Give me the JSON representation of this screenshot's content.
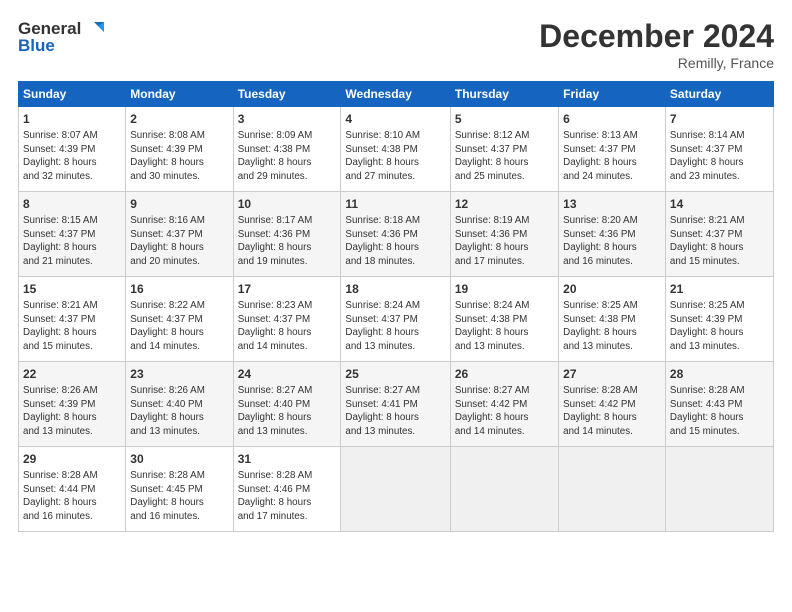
{
  "header": {
    "title": "December 2024",
    "location": "Remilly, France"
  },
  "logo": {
    "line1": "General",
    "line2": "Blue"
  },
  "days_of_week": [
    "Sunday",
    "Monday",
    "Tuesday",
    "Wednesday",
    "Thursday",
    "Friday",
    "Saturday"
  ],
  "weeks": [
    [
      {
        "num": "1",
        "info": "Sunrise: 8:07 AM\nSunset: 4:39 PM\nDaylight: 8 hours\nand 32 minutes."
      },
      {
        "num": "2",
        "info": "Sunrise: 8:08 AM\nSunset: 4:39 PM\nDaylight: 8 hours\nand 30 minutes."
      },
      {
        "num": "3",
        "info": "Sunrise: 8:09 AM\nSunset: 4:38 PM\nDaylight: 8 hours\nand 29 minutes."
      },
      {
        "num": "4",
        "info": "Sunrise: 8:10 AM\nSunset: 4:38 PM\nDaylight: 8 hours\nand 27 minutes."
      },
      {
        "num": "5",
        "info": "Sunrise: 8:12 AM\nSunset: 4:37 PM\nDaylight: 8 hours\nand 25 minutes."
      },
      {
        "num": "6",
        "info": "Sunrise: 8:13 AM\nSunset: 4:37 PM\nDaylight: 8 hours\nand 24 minutes."
      },
      {
        "num": "7",
        "info": "Sunrise: 8:14 AM\nSunset: 4:37 PM\nDaylight: 8 hours\nand 23 minutes."
      }
    ],
    [
      {
        "num": "8",
        "info": "Sunrise: 8:15 AM\nSunset: 4:37 PM\nDaylight: 8 hours\nand 21 minutes."
      },
      {
        "num": "9",
        "info": "Sunrise: 8:16 AM\nSunset: 4:37 PM\nDaylight: 8 hours\nand 20 minutes."
      },
      {
        "num": "10",
        "info": "Sunrise: 8:17 AM\nSunset: 4:36 PM\nDaylight: 8 hours\nand 19 minutes."
      },
      {
        "num": "11",
        "info": "Sunrise: 8:18 AM\nSunset: 4:36 PM\nDaylight: 8 hours\nand 18 minutes."
      },
      {
        "num": "12",
        "info": "Sunrise: 8:19 AM\nSunset: 4:36 PM\nDaylight: 8 hours\nand 17 minutes."
      },
      {
        "num": "13",
        "info": "Sunrise: 8:20 AM\nSunset: 4:36 PM\nDaylight: 8 hours\nand 16 minutes."
      },
      {
        "num": "14",
        "info": "Sunrise: 8:21 AM\nSunset: 4:37 PM\nDaylight: 8 hours\nand 15 minutes."
      }
    ],
    [
      {
        "num": "15",
        "info": "Sunrise: 8:21 AM\nSunset: 4:37 PM\nDaylight: 8 hours\nand 15 minutes."
      },
      {
        "num": "16",
        "info": "Sunrise: 8:22 AM\nSunset: 4:37 PM\nDaylight: 8 hours\nand 14 minutes."
      },
      {
        "num": "17",
        "info": "Sunrise: 8:23 AM\nSunset: 4:37 PM\nDaylight: 8 hours\nand 14 minutes."
      },
      {
        "num": "18",
        "info": "Sunrise: 8:24 AM\nSunset: 4:37 PM\nDaylight: 8 hours\nand 13 minutes."
      },
      {
        "num": "19",
        "info": "Sunrise: 8:24 AM\nSunset: 4:38 PM\nDaylight: 8 hours\nand 13 minutes."
      },
      {
        "num": "20",
        "info": "Sunrise: 8:25 AM\nSunset: 4:38 PM\nDaylight: 8 hours\nand 13 minutes."
      },
      {
        "num": "21",
        "info": "Sunrise: 8:25 AM\nSunset: 4:39 PM\nDaylight: 8 hours\nand 13 minutes."
      }
    ],
    [
      {
        "num": "22",
        "info": "Sunrise: 8:26 AM\nSunset: 4:39 PM\nDaylight: 8 hours\nand 13 minutes."
      },
      {
        "num": "23",
        "info": "Sunrise: 8:26 AM\nSunset: 4:40 PM\nDaylight: 8 hours\nand 13 minutes."
      },
      {
        "num": "24",
        "info": "Sunrise: 8:27 AM\nSunset: 4:40 PM\nDaylight: 8 hours\nand 13 minutes."
      },
      {
        "num": "25",
        "info": "Sunrise: 8:27 AM\nSunset: 4:41 PM\nDaylight: 8 hours\nand 13 minutes."
      },
      {
        "num": "26",
        "info": "Sunrise: 8:27 AM\nSunset: 4:42 PM\nDaylight: 8 hours\nand 14 minutes."
      },
      {
        "num": "27",
        "info": "Sunrise: 8:28 AM\nSunset: 4:42 PM\nDaylight: 8 hours\nand 14 minutes."
      },
      {
        "num": "28",
        "info": "Sunrise: 8:28 AM\nSunset: 4:43 PM\nDaylight: 8 hours\nand 15 minutes."
      }
    ],
    [
      {
        "num": "29",
        "info": "Sunrise: 8:28 AM\nSunset: 4:44 PM\nDaylight: 8 hours\nand 16 minutes."
      },
      {
        "num": "30",
        "info": "Sunrise: 8:28 AM\nSunset: 4:45 PM\nDaylight: 8 hours\nand 16 minutes."
      },
      {
        "num": "31",
        "info": "Sunrise: 8:28 AM\nSunset: 4:46 PM\nDaylight: 8 hours\nand 17 minutes."
      },
      null,
      null,
      null,
      null
    ]
  ]
}
